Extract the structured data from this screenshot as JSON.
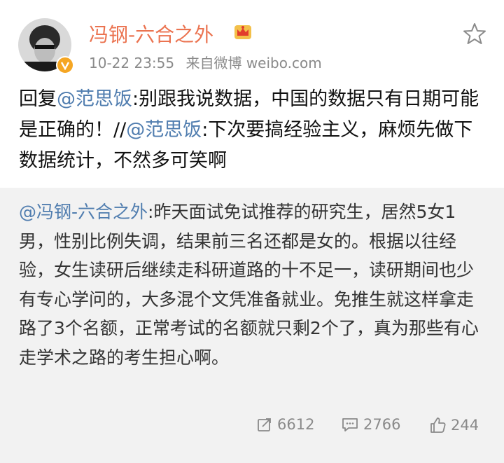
{
  "post": {
    "author": "冯钢-六合之外",
    "time": "10-22 23:55",
    "source": "来自微博 weibo.com",
    "reply_prefix": "回复",
    "reply_mention1": "@范思饭",
    "reply_text1": ":别跟我说数据，中国的数据只有日期可能是正确的！//",
    "reply_mention2": "@范思饭",
    "reply_text2": ":下次要搞经验主义，麻烦先做下数据统计，不然多可笑啊"
  },
  "quoted": {
    "mention": "@冯钢-六合之外",
    "text": ":昨天面试免试推荐的研究生，居然5女1男，性别比例失调，结果前三名还都是女的。根据以往经验，女生读研后继续走科研道路的十不足一，读研期间也少有专心学问的，大多混个文凭准备就业。免推生就这样拿走路了3个名额，正常考试的名额就只剩2个了，真为那些有心走学术之路的考生担心啊。",
    "reposts": "6612",
    "comments": "2766",
    "likes": "244"
  },
  "colors": {
    "author": "#eb7350",
    "link": "#507daf",
    "meta": "#8a8a8a",
    "quote_bg": "#f2f2f2",
    "badge": "#f5a623"
  },
  "icons": [
    "avatar",
    "verified-badge-icon",
    "crown-icon",
    "star-icon",
    "repost-icon",
    "comment-icon",
    "like-icon"
  ]
}
